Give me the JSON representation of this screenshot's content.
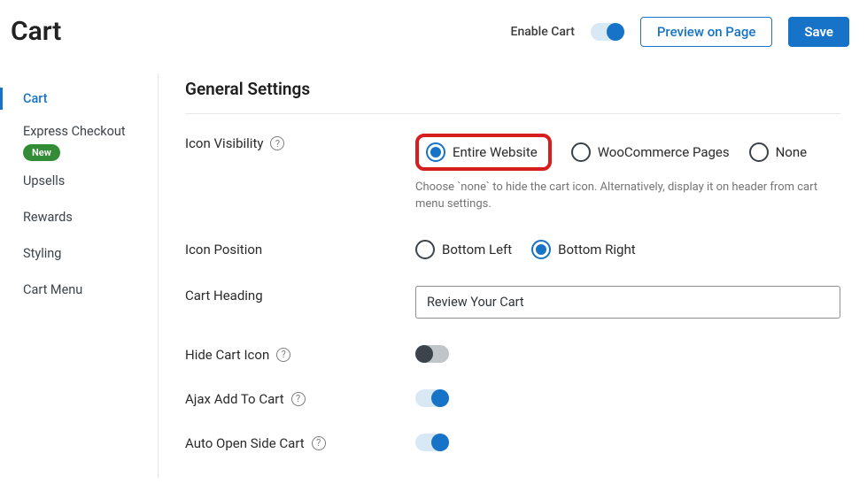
{
  "header": {
    "title": "Cart",
    "enable_label": "Enable Cart",
    "preview_btn": "Preview on Page",
    "save_btn": "Save"
  },
  "sidebar": {
    "cart": "Cart",
    "express_checkout": "Express Checkout",
    "new_badge": "New",
    "upsells": "Upsells",
    "rewards": "Rewards",
    "styling": "Styling",
    "cart_menu": "Cart Menu"
  },
  "section": {
    "title": "General Settings"
  },
  "fields": {
    "icon_visibility": {
      "label": "Icon Visibility",
      "options": {
        "entire": "Entire Website",
        "woo": "WooCommerce Pages",
        "none": "None"
      },
      "helper": "Choose `none` to hide the cart icon. Alternatively, display it on header from cart menu settings."
    },
    "icon_position": {
      "label": "Icon Position",
      "options": {
        "bl": "Bottom Left",
        "br": "Bottom Right"
      }
    },
    "cart_heading": {
      "label": "Cart Heading",
      "value": "Review Your Cart"
    },
    "hide_cart_icon": {
      "label": "Hide Cart Icon"
    },
    "ajax_add": {
      "label": "Ajax Add To Cart"
    },
    "auto_open": {
      "label": "Auto Open Side Cart"
    }
  }
}
